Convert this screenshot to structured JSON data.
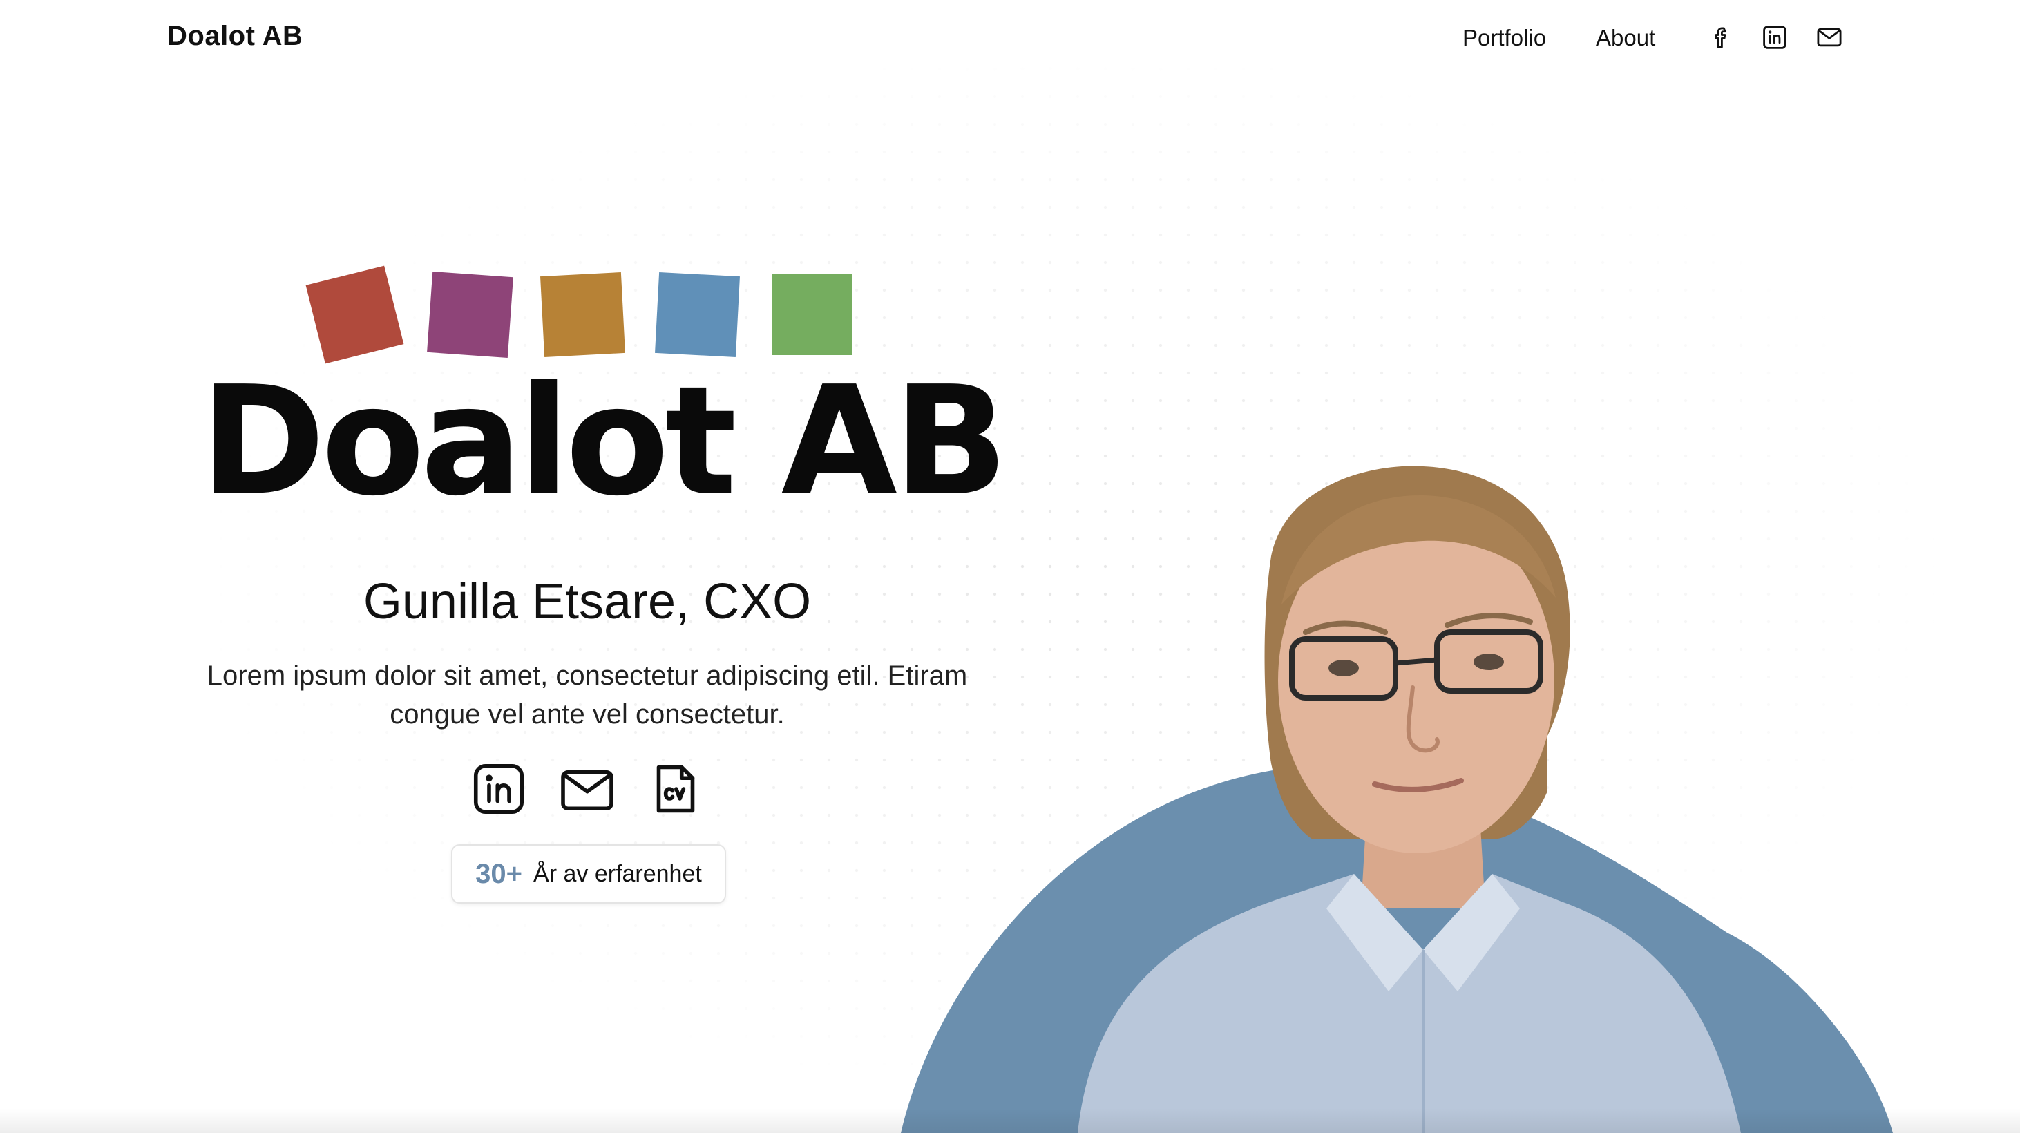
{
  "header": {
    "brand": "Doalot AB",
    "nav": {
      "portfolio": "Portfolio",
      "about": "About"
    },
    "icons": [
      "facebook-icon",
      "linkedin-icon",
      "mail-icon"
    ]
  },
  "hero": {
    "logo": {
      "wordmark": "Doalot AB",
      "square_colors": [
        "#b04a3c",
        "#8e4478",
        "#b78236",
        "#6090b8",
        "#75ad5f"
      ]
    },
    "name": "Gunilla Etsare, CXO",
    "description": "Lorem ipsum dolor sit amet, consectetur adipiscing etil. Etiram congue vel ante vel consectetur.",
    "icons": [
      "linkedin-icon",
      "mail-icon",
      "cv-file-icon"
    ],
    "experience": {
      "number": "30+",
      "label": "År av erfarenhet"
    }
  },
  "colors": {
    "accent_blue": "#6a8aaa",
    "blob_blue": "#6b8fae"
  }
}
